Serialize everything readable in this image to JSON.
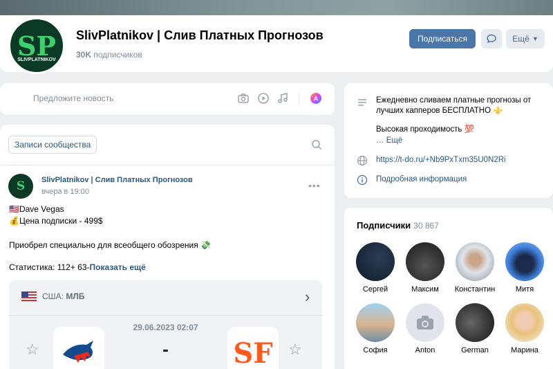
{
  "group": {
    "avatar_letters": "SP",
    "avatar_caption": "SLIVPLATNIKOV",
    "name": "SlivPlatnikov | Слив Платных Прогнозов",
    "subscribers_count": "30K",
    "subscribers_label": "подписчиков",
    "subscribe_label": "Подписаться",
    "more_label": "Ещё"
  },
  "suggest": {
    "placeholder": "Предложите новость"
  },
  "feed": {
    "tab_label": "Записи сообщества"
  },
  "post": {
    "author": "SlivPlatnikov | Слив Платных Прогнозов",
    "time": "вчера в 19:00",
    "lines": [
      "🇺🇸Dave Vegas",
      "💰Цена подписки - 499$",
      "Приобрел специально для всеобщего обозрения 💸",
      "Статистика: 112+ 63-"
    ],
    "show_more": "Показать ещё"
  },
  "match": {
    "country": "США:",
    "league": "МЛБ",
    "datetime": "29.06.2023 02:07",
    "score": "-"
  },
  "about": {
    "description_1": "Ежедневно сливаем платные прогнозы от лучших капперов БЕСПЛАТНО ⚜️",
    "description_2": "Высокая проходимость 💯",
    "more": "… Ещё",
    "url": "https://t-do.ru/+Nb9PxTxm35U0N2Ri",
    "details": "Подробная информация"
  },
  "subscribers": {
    "title": "Подписчики",
    "count": "30 867",
    "members": [
      {
        "name": "Сергей"
      },
      {
        "name": "Максим"
      },
      {
        "name": "Константин"
      },
      {
        "name": "Митя"
      },
      {
        "name": "София"
      },
      {
        "name": "Anton"
      },
      {
        "name": "German"
      },
      {
        "name": "Марина"
      }
    ]
  },
  "colors": {
    "accent": "#4a76a8",
    "link": "#2a5885",
    "brand_green": "#3ecf6e"
  }
}
